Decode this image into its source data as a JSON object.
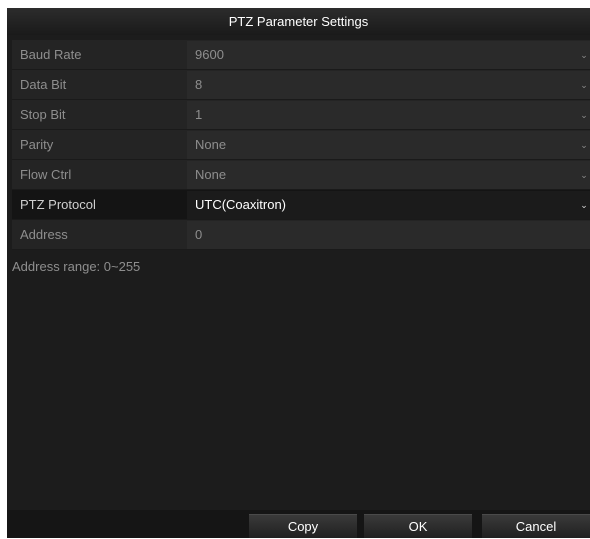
{
  "dialog": {
    "title": "PTZ Parameter Settings"
  },
  "rows": [
    {
      "label": "Baud Rate",
      "value": "9600"
    },
    {
      "label": "Data Bit",
      "value": "8"
    },
    {
      "label": "Stop Bit",
      "value": "1"
    },
    {
      "label": "Parity",
      "value": "None"
    },
    {
      "label": "Flow Ctrl",
      "value": "None"
    },
    {
      "label": "PTZ Protocol",
      "value": "UTC(Coaxitron)"
    },
    {
      "label": "Address",
      "value": "0"
    }
  ],
  "hint": "Address range: 0~255",
  "buttons": {
    "copy": "Copy",
    "ok": "OK",
    "cancel": "Cancel"
  },
  "icons": {
    "dropdown": "chevron-down-icon"
  }
}
